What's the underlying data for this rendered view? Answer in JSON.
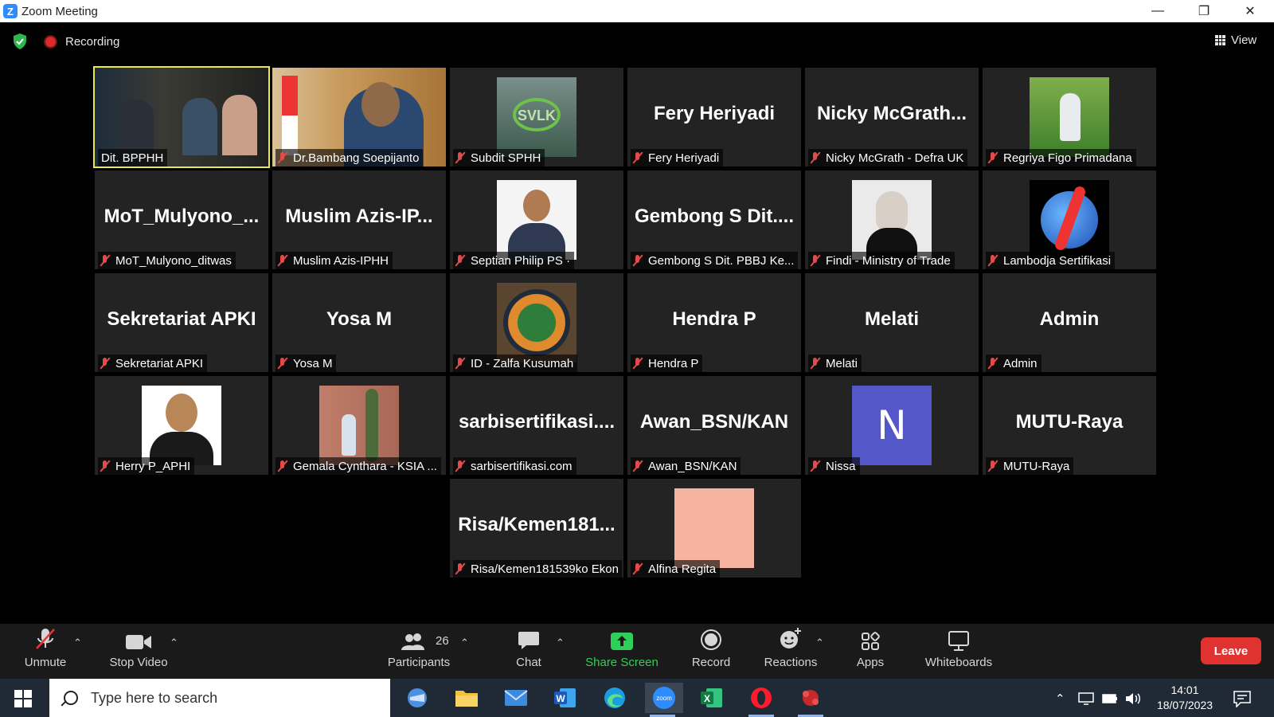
{
  "window": {
    "title": "Zoom Meeting",
    "minimize": "—",
    "restore": "❐",
    "close": "✕"
  },
  "meeting": {
    "recording_label": "Recording",
    "view_label": "View",
    "tiles": [
      {
        "name": "Dit. BPPHH",
        "big": "",
        "muted": false,
        "active": true,
        "kind": "cam-bpphh"
      },
      {
        "name": "Dr.Bambang Soepijanto",
        "big": "",
        "muted": true,
        "active": false,
        "kind": "cam-bambang"
      },
      {
        "name": "Subdit SPHH",
        "big": "",
        "muted": true,
        "kind": "svlk",
        "avatar_text": "SVLK"
      },
      {
        "name": "Fery Heriyadi",
        "big": "Fery Heriyadi",
        "muted": true
      },
      {
        "name": "Nicky McGrath - Defra UK",
        "big": "Nicky  McGrath...",
        "muted": true
      },
      {
        "name": "Regriya Figo Primadana",
        "big": "",
        "muted": true,
        "kind": "regriya"
      },
      {
        "name": "MoT_Mulyono_ditwas",
        "big": "MoT_Mulyono_...",
        "muted": true
      },
      {
        "name": "Muslim Azis-IPHH",
        "big": "Muslim  Azis-IP...",
        "muted": true
      },
      {
        "name": "Septian Philip PS  ·",
        "big": "",
        "muted": true,
        "kind": "septian"
      },
      {
        "name": "Gembong S Dit. PBBJ Ke...",
        "big": "Gembong  S  Dit....",
        "muted": true
      },
      {
        "name": "Findi - Ministry of Trade",
        "big": "",
        "muted": true,
        "kind": "findi"
      },
      {
        "name": "Lambodja Sertifikasi",
        "big": "",
        "muted": true,
        "kind": "lambodja"
      },
      {
        "name": "Sekretariat APKI",
        "big": "Sekretariat APKI",
        "muted": true
      },
      {
        "name": "Yosa M",
        "big": "Yosa M",
        "muted": true
      },
      {
        "name": "ID - Zalfa Kusumah",
        "big": "",
        "muted": true,
        "kind": "klhk"
      },
      {
        "name": "Hendra P",
        "big": "Hendra P",
        "muted": true
      },
      {
        "name": "Melati",
        "big": "Melati",
        "muted": true
      },
      {
        "name": "Admin",
        "big": "Admin",
        "muted": true
      },
      {
        "name": "Herry P_APHI",
        "big": "",
        "muted": true,
        "kind": "herry"
      },
      {
        "name": "Gemala Cynthara - KSIA ...",
        "big": "",
        "muted": true,
        "kind": "gemala"
      },
      {
        "name": "sarbisertifikasi.com",
        "big": "sarbisertifikasi....",
        "muted": true
      },
      {
        "name": "Awan_BSN/KAN",
        "big": "Awan_BSN/KAN",
        "muted": true
      },
      {
        "name": "Nissa",
        "big": "",
        "muted": true,
        "kind": "n",
        "avatar_text": "N"
      },
      {
        "name": "MUTU-Raya",
        "big": "MUTU-Raya",
        "muted": true
      },
      {
        "name": "Risa/Kemen181539ko Ekon",
        "big": "Risa/Kemen181...",
        "muted": true
      },
      {
        "name": "Alfina Regita",
        "big": "",
        "muted": true,
        "kind": "alfina"
      }
    ]
  },
  "toolbar": {
    "unmute": "Unmute",
    "stop_video": "Stop Video",
    "participants": "Participants",
    "participants_count": "26",
    "chat": "Chat",
    "share_screen": "Share Screen",
    "record": "Record",
    "reactions": "Reactions",
    "apps": "Apps",
    "whiteboards": "Whiteboards",
    "leave": "Leave",
    "share_color": "#2fd05a",
    "leave_color": "#e0322f"
  },
  "taskbar": {
    "search_placeholder": "Type here to search",
    "time": "14:01",
    "date": "18/07/2023",
    "zoom_app_label": "zoom",
    "excel_label": "X",
    "word_label": "W"
  }
}
